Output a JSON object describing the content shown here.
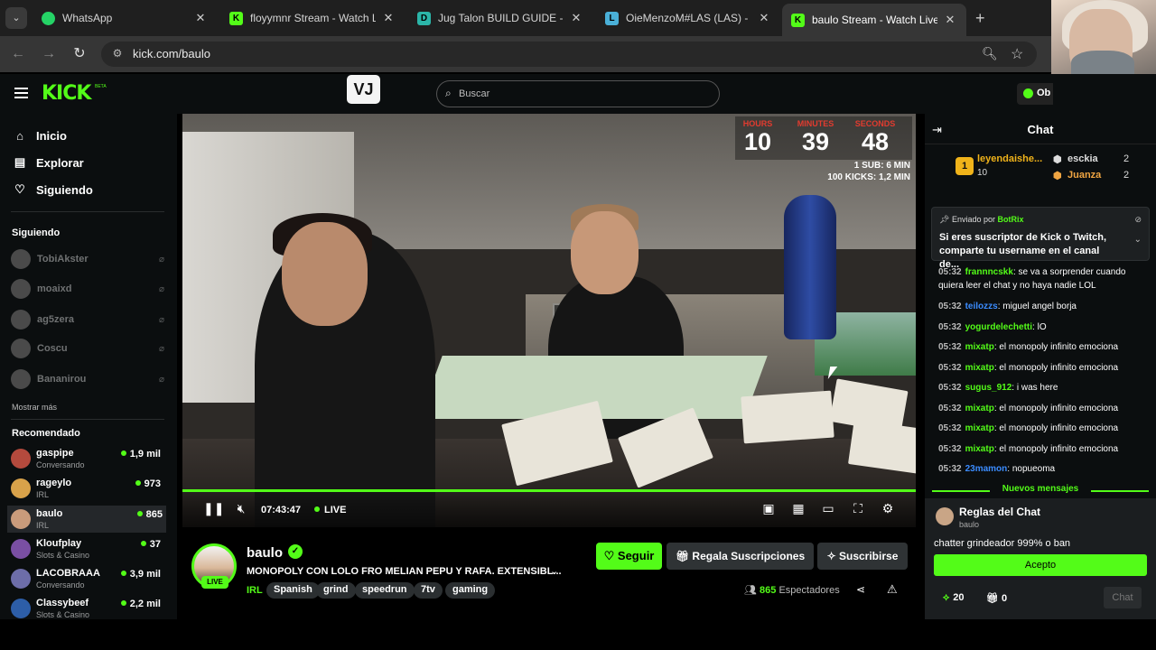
{
  "browser": {
    "tabs": [
      {
        "title": "WhatsApp",
        "favicon": "whatsapp-icon",
        "color": "#25d366",
        "glyph": "",
        "active": false
      },
      {
        "title": "floyymnr Stream - Watch Live on",
        "favicon": "kick-icon",
        "color": "#53fc18",
        "glyph": "K",
        "active": false
      },
      {
        "title": "Jug Talon BUILD GUIDE - RU",
        "favicon": "d-icon",
        "color": "#2bb5a8",
        "glyph": "D",
        "active": false
      },
      {
        "title": "OieMenzoM#LAS (LAS) - League",
        "favicon": "l-icon",
        "color": "#4ab0d8",
        "glyph": "L",
        "active": false
      },
      {
        "title": "baulo Stream - Watch Live on",
        "favicon": "kick-icon",
        "color": "#53fc18",
        "glyph": "K",
        "active": true
      }
    ],
    "url": "kick.com/baulo"
  },
  "header": {
    "logo": "KICK",
    "beta": "BETA",
    "extension_logo": "VJ",
    "search_placeholder": "Buscar",
    "obs_label": "Ob"
  },
  "sidebar": {
    "nav": [
      {
        "label": "Inicio",
        "icon": "home-icon"
      },
      {
        "label": "Explorar",
        "icon": "browse-icon"
      },
      {
        "label": "Siguiendo",
        "icon": "heart-icon"
      }
    ],
    "following_title": "Siguiendo",
    "following": [
      "TobiAkster",
      "moaixd",
      "ag5zera",
      "Coscu",
      "Bananirou"
    ],
    "show_more": "Mostrar más",
    "recommended_title": "Recomendado",
    "recommended": [
      {
        "name": "gaspipe",
        "category": "Conversando",
        "viewers": "1,9 mil",
        "color": "#b44a3d",
        "active": false
      },
      {
        "name": "rageylo",
        "category": "IRL",
        "viewers": "973",
        "color": "#d8a24a",
        "active": false
      },
      {
        "name": "baulo",
        "category": "IRL",
        "viewers": "865",
        "color": "#c99b7b",
        "active": true
      },
      {
        "name": "Kloufplay",
        "category": "Slots & Casino",
        "viewers": "37",
        "color": "#7a4fa3",
        "active": false
      },
      {
        "name": "LACOBRAAA",
        "category": "Conversando",
        "viewers": "3,9 mil",
        "color": "#6d6da8",
        "active": false
      },
      {
        "name": "Classybeef",
        "category": "Slots & Casino",
        "viewers": "2,2 mil",
        "color": "#2d5ea8",
        "active": false
      }
    ]
  },
  "video": {
    "timer": {
      "labels": [
        "HOURS",
        "MINUTES",
        "SECONDS"
      ],
      "values": [
        "10",
        "39",
        "48"
      ],
      "info1": "1 SUB: 6 MIN",
      "info2": "100 KICKS: 1,2 MIN"
    },
    "elapsed": "07:43:47",
    "live_label": "LIVE",
    "progress": 1.0
  },
  "stream": {
    "channel": "baulo",
    "live_badge": "LIVE",
    "title": "MONOPOLY CON LOLO FRO MELIAN PEPU Y RAFA. EXTENSIBL...",
    "category": "IRL",
    "tags": [
      "Spanish",
      "grind",
      "speedrun",
      "7tv",
      "gaming"
    ],
    "follow_label": "Seguir",
    "gift_label": "Regala Suscripciones",
    "subscribe_label": "Suscribirse",
    "viewers": "865",
    "viewers_label": "Espectadores"
  },
  "chat": {
    "title": "Chat",
    "leaderboard": {
      "first": {
        "name": "leyendaishe...",
        "count": "10"
      },
      "others": [
        {
          "name": "esckia",
          "count": "2",
          "color": "#dddddd"
        },
        {
          "name": "Juanza",
          "count": "2",
          "color": "#f0a542"
        }
      ]
    },
    "pinned": {
      "by_label": "Enviado por",
      "by_user": "BotRix",
      "message": "Si eres suscriptor de Kick o Twitch, comparte tu username en el canal de..."
    },
    "messages": [
      {
        "time": "05:32",
        "user": "frannncskk",
        "color": "#53fc18",
        "text": "se va a sorprender cuando quiera leer el chat y no haya nadie LOL"
      },
      {
        "time": "05:32",
        "user": "teilozzs",
        "color": "#3b8cff",
        "text": "miguel angel borja"
      },
      {
        "time": "05:32",
        "user": "yogurdelechetti",
        "color": "#53fc18",
        "text": "lO"
      },
      {
        "time": "05:32",
        "user": "mixatp",
        "color": "#53fc18",
        "text": "el monopoly infinito emociona"
      },
      {
        "time": "05:32",
        "user": "mixatp",
        "color": "#53fc18",
        "text": "el monopoly infinito emociona"
      },
      {
        "time": "05:32",
        "user": "sugus_912",
        "color": "#53fc18",
        "text": "i was here"
      },
      {
        "time": "05:32",
        "user": "mixatp",
        "color": "#53fc18",
        "text": "el monopoly infinito emociona"
      },
      {
        "time": "05:32",
        "user": "mixatp",
        "color": "#53fc18",
        "text": "el monopoly infinito emociona"
      },
      {
        "time": "05:32",
        "user": "mixatp",
        "color": "#53fc18",
        "text": "el monopoly infinito emociona"
      },
      {
        "time": "05:32",
        "user": "23mamon",
        "color": "#3b8cff",
        "text": "nopueoma"
      }
    ],
    "new_messages": "Nuevos mensajes",
    "rules": {
      "title": "Reglas del Chat",
      "channel": "baulo",
      "rule": "chatter grindeador 999% o ban",
      "accept": "Acepto"
    },
    "points": "20",
    "gifts": "0",
    "send_label": "Chat"
  }
}
